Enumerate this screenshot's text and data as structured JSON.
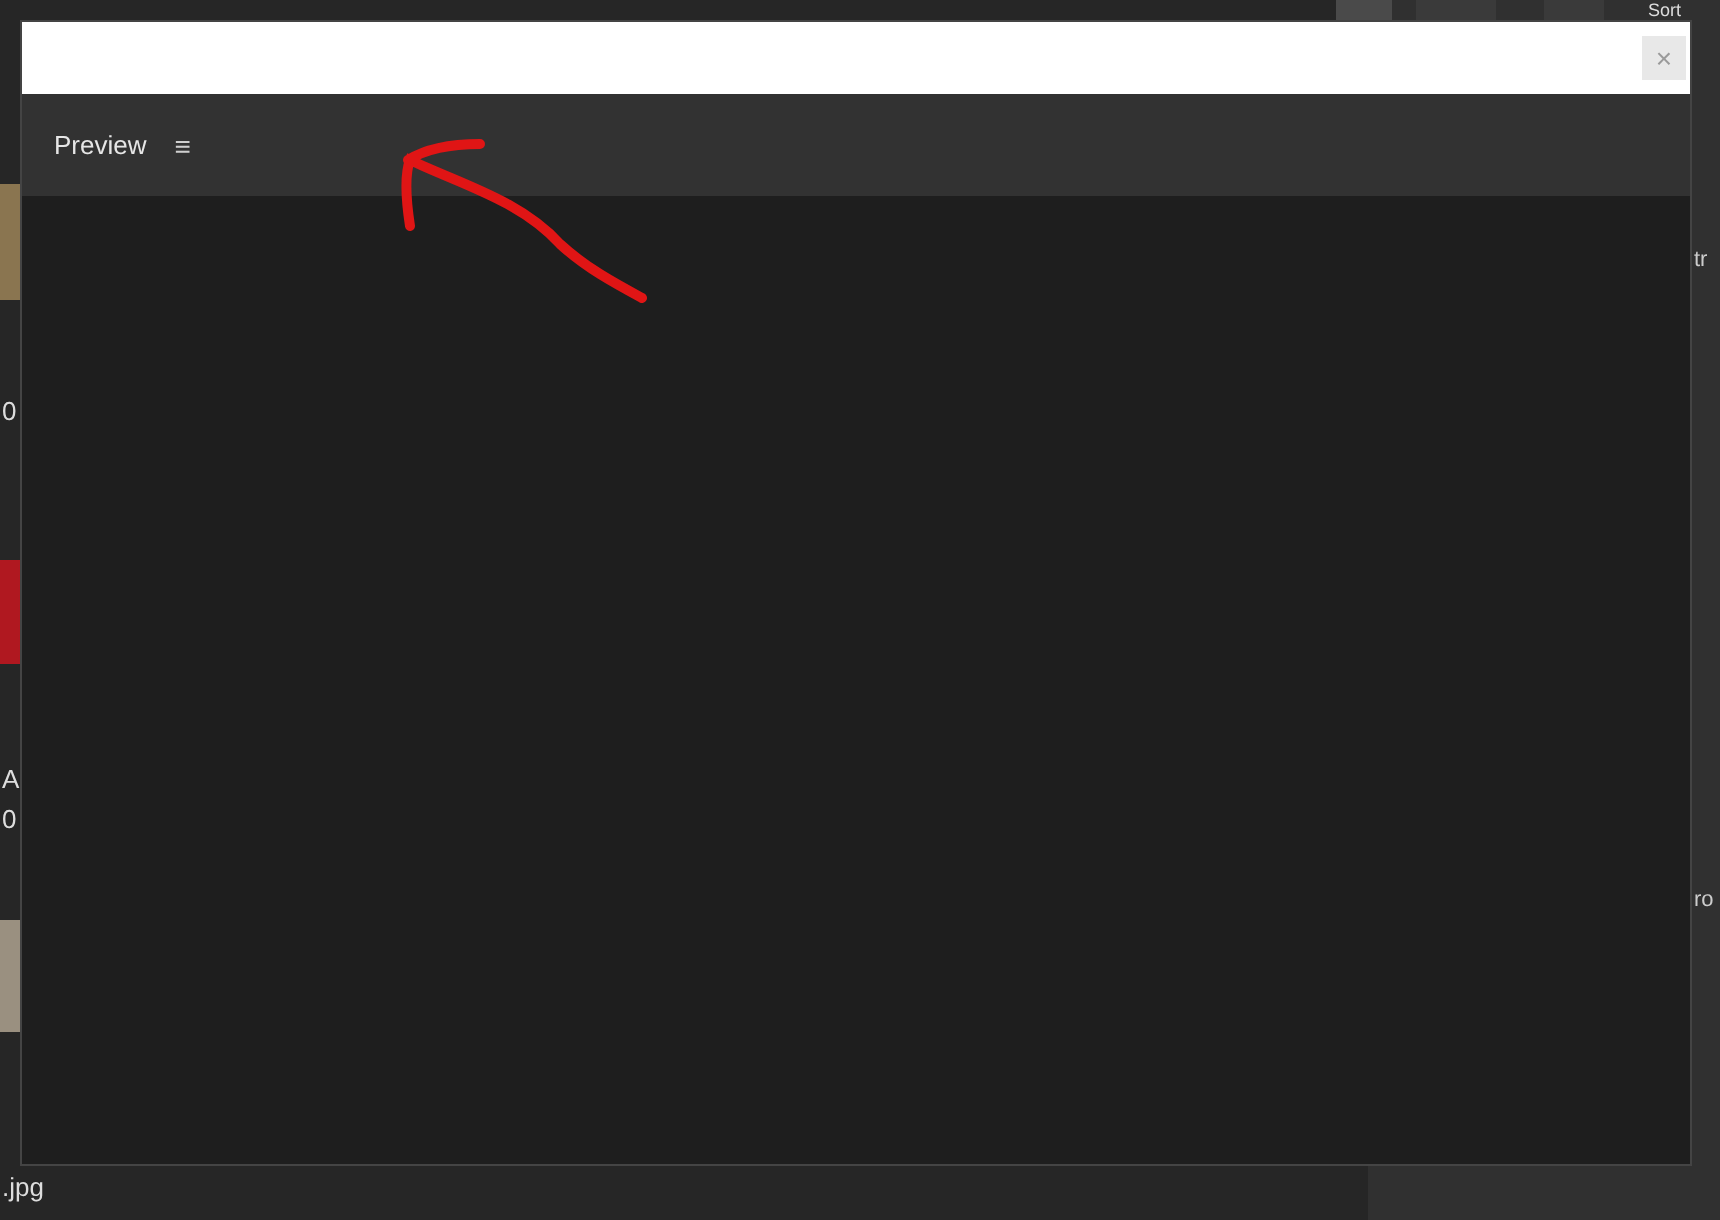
{
  "background": {
    "toolbar_label": "Sort",
    "left_texts": [
      "0",
      "A",
      "0",
      ".jpg"
    ],
    "right_texts": [
      "tr",
      "ro"
    ]
  },
  "dialog": {
    "close": "×",
    "header": {
      "label": "Preview",
      "menu": "≡"
    }
  }
}
